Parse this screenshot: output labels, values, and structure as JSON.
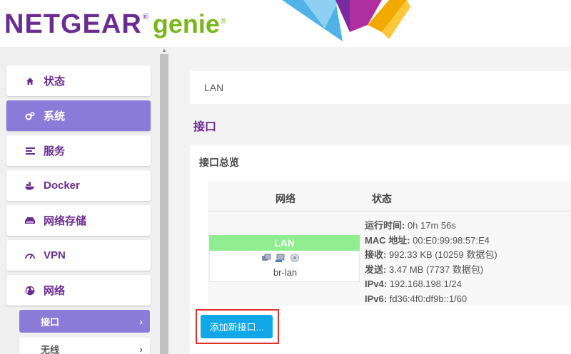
{
  "brand": {
    "name": "NETGEAR",
    "product": "genie",
    "reg_mark": "®",
    "colors": {
      "purple": "#6b2c91",
      "green": "#7ab51d"
    }
  },
  "sidebar": {
    "items": [
      {
        "label": "状态",
        "icon": "home-icon"
      },
      {
        "label": "系统",
        "icon": "gears-icon",
        "active": true
      },
      {
        "label": "服务",
        "icon": "list-icon"
      },
      {
        "label": "Docker",
        "icon": "docker-icon"
      },
      {
        "label": "网络存储",
        "icon": "storage-icon"
      },
      {
        "label": "VPN",
        "icon": "gauge-icon"
      },
      {
        "label": "网络",
        "icon": "globe-icon"
      }
    ],
    "subitems": [
      {
        "label": "接口",
        "chevron": "›",
        "active": true
      },
      {
        "label": "无线",
        "chevron": "›"
      }
    ],
    "colors": {
      "active_bg": "#8a7bd8"
    }
  },
  "main": {
    "breadcrumb": "LAN",
    "page_title": "接口",
    "panel_title": "接口总览",
    "table": {
      "headers": {
        "network": "网络",
        "status": "状态"
      },
      "rows": [
        {
          "name": "LAN",
          "device": "br-lan",
          "status": [
            {
              "key": "运行时间:",
              "value": " 0h 17m 56s"
            },
            {
              "key": "MAC 地址:",
              "value": " 00:E0:99:98:57:E4"
            },
            {
              "key": "接收:",
              "value": " 992.33 KB (10259 数据包)"
            },
            {
              "key": "发送:",
              "value": " 3.47 MB (7737 数据包)"
            },
            {
              "key": "IPv4:",
              "value": " 192.168.198.1/24"
            },
            {
              "key": "IPv6:",
              "value": " fd36:4f0:df9b::1/60"
            }
          ]
        }
      ]
    },
    "add_button": "添加新接口...",
    "colors": {
      "lan_badge": "#90ee90",
      "button": "#0fa7e6",
      "highlight": "#e0322c"
    }
  }
}
